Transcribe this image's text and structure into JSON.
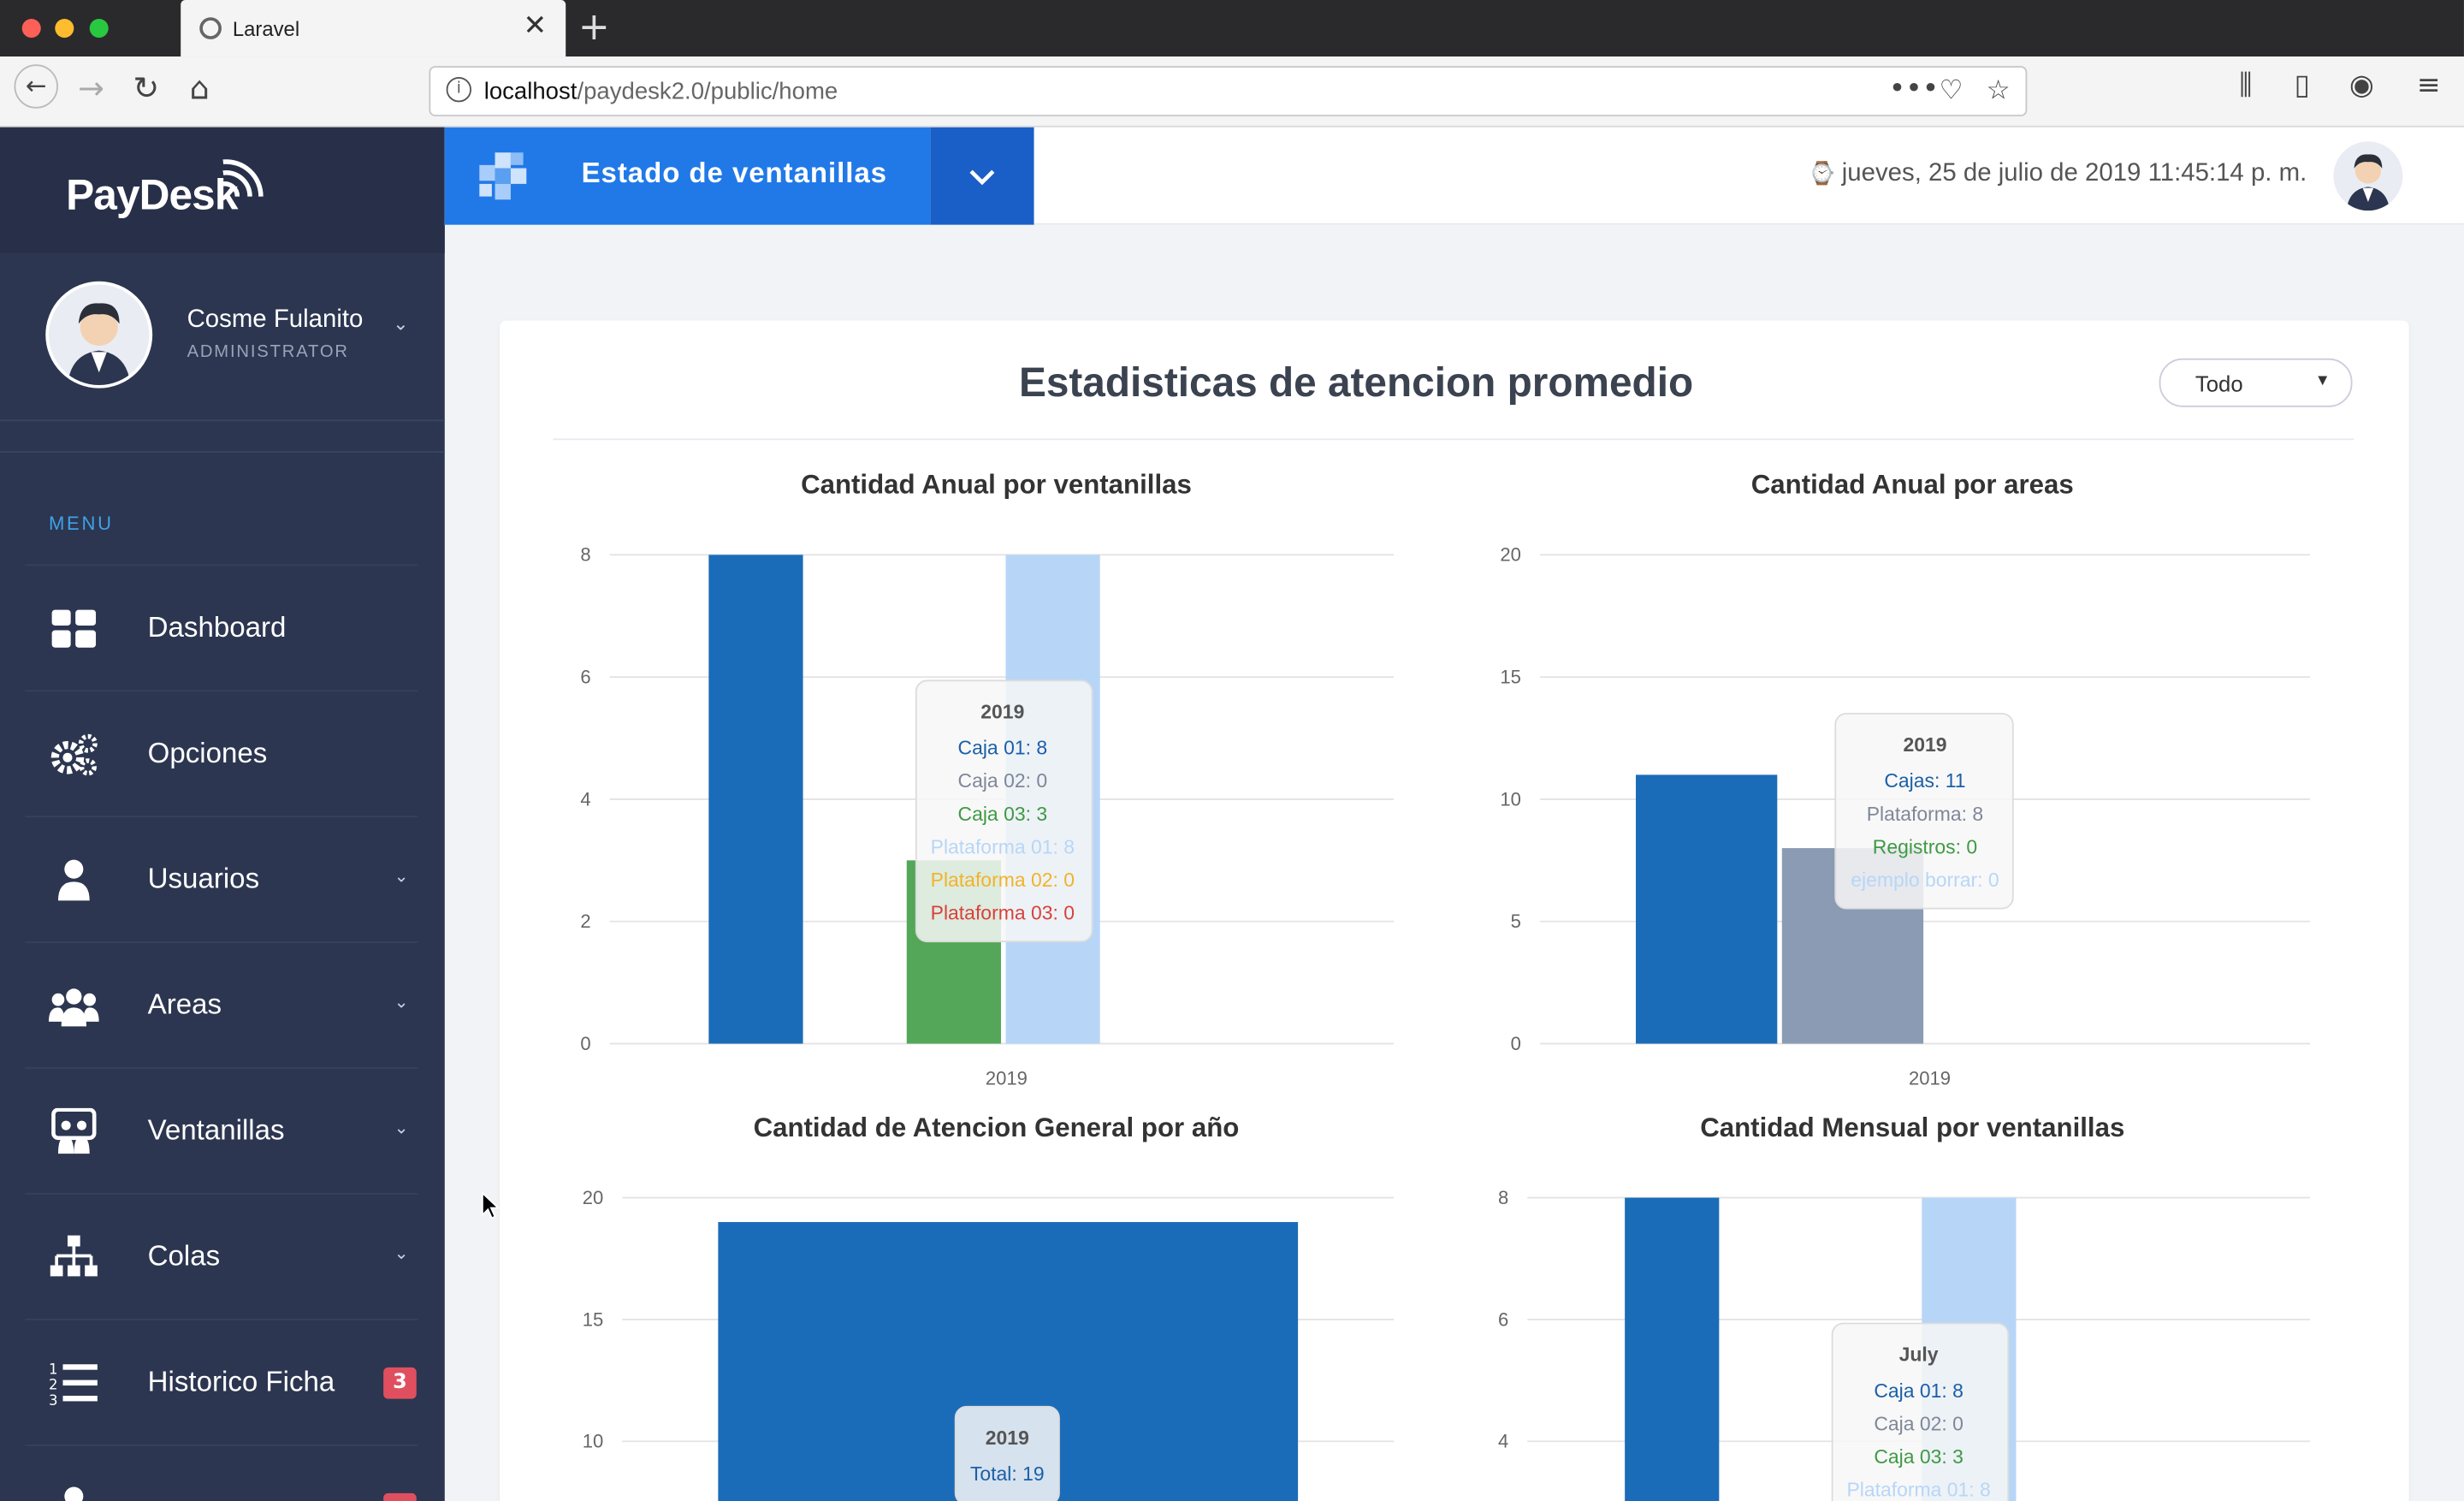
{
  "browser": {
    "tab_title": "Laravel",
    "url_host": "localhost",
    "url_path": "/paydesk2.0/public/home",
    "new_tab_symbol": "+",
    "close_symbol": "✕"
  },
  "sidebar": {
    "brand": "PayDesk",
    "user_name": "Cosme Fulanito",
    "user_role": "ADMINISTRATOR",
    "menu_label": "MENU",
    "items": [
      {
        "label": "Dashboard",
        "icon": "dashboard-grid-icon"
      },
      {
        "label": "Opciones",
        "icon": "gears-icon"
      },
      {
        "label": "Usuarios",
        "icon": "user-icon"
      },
      {
        "label": "Areas",
        "icon": "users-group-icon"
      },
      {
        "label": "Ventanillas",
        "icon": "window-icon"
      },
      {
        "label": "Colas",
        "icon": "sitemap-icon"
      },
      {
        "label": "Historico Ficha",
        "icon": "numbered-list-icon",
        "badge": "3"
      }
    ]
  },
  "topbar": {
    "title": "Estado de ventanillas",
    "datetime": "jueves, 25 de julio de 2019 11:45:14 p. m."
  },
  "card": {
    "title": "Estadisticas de atencion promedio",
    "filter_value": "Todo"
  },
  "colors": {
    "blue": "#1b6cb8",
    "gray": "#8a9bb3",
    "green": "#54a758",
    "lightblue": "#b7d6f7",
    "orange": "#f0b429",
    "red": "#d9413a",
    "accent": "#2179e8"
  },
  "chart_data": [
    {
      "type": "bar",
      "title": "Cantidad Anual por ventanillas",
      "categories": [
        "2019"
      ],
      "yticks": [
        "0",
        "2",
        "4",
        "6",
        "8"
      ],
      "ylim": [
        0,
        8
      ],
      "series": [
        {
          "name": "Caja 01",
          "values": [
            8
          ],
          "color": "#1b6cb8"
        },
        {
          "name": "Caja 02",
          "values": [
            0
          ],
          "color": "#8a9bb3"
        },
        {
          "name": "Caja 03",
          "values": [
            3
          ],
          "color": "#54a758"
        },
        {
          "name": "Plataforma 01",
          "values": [
            8
          ],
          "color": "#b7d6f7"
        },
        {
          "name": "Plataforma 02",
          "values": [
            0
          ],
          "color": "#f0b429"
        },
        {
          "name": "Plataforma 03",
          "values": [
            0
          ],
          "color": "#d9413a"
        }
      ],
      "tooltip": {
        "header": "2019",
        "lines": [
          "Caja 01: 8",
          "Caja 02: 0",
          "Caja 03: 3",
          "Plataforma 01: 8",
          "Plataforma 02: 0",
          "Plataforma 03: 0"
        ]
      }
    },
    {
      "type": "bar",
      "title": "Cantidad Anual por areas",
      "categories": [
        "2019"
      ],
      "yticks": [
        "0",
        "5",
        "10",
        "15",
        "20"
      ],
      "ylim": [
        0,
        20
      ],
      "series": [
        {
          "name": "Cajas",
          "values": [
            11
          ],
          "color": "#1b6cb8"
        },
        {
          "name": "Plataforma",
          "values": [
            8
          ],
          "color": "#8a9bb3"
        },
        {
          "name": "Registros",
          "values": [
            0
          ],
          "color": "#54a758"
        },
        {
          "name": "ejemplo borrar",
          "values": [
            0
          ],
          "color": "#b7d6f7"
        }
      ],
      "tooltip": {
        "header": "2019",
        "lines": [
          "Cajas: 11",
          "Plataforma: 8",
          "Registros: 0",
          "ejemplo borrar: 0"
        ]
      }
    },
    {
      "type": "bar",
      "title": "Cantidad de Atencion General por año",
      "categories": [
        "2019"
      ],
      "yticks": [
        "10",
        "15",
        "20"
      ],
      "ylim": [
        0,
        20
      ],
      "series": [
        {
          "name": "Total",
          "values": [
            19
          ],
          "color": "#1b6cb8"
        }
      ],
      "tooltip": {
        "header": "2019",
        "lines": [
          "Total: 19"
        ]
      }
    },
    {
      "type": "bar",
      "title": "Cantidad Mensual por ventanillas",
      "categories": [
        "July"
      ],
      "yticks": [
        "4",
        "6",
        "8"
      ],
      "ylim": [
        0,
        8
      ],
      "series": [
        {
          "name": "Caja 01",
          "values": [
            8
          ],
          "color": "#1b6cb8"
        },
        {
          "name": "Caja 02",
          "values": [
            0
          ],
          "color": "#8a9bb3"
        },
        {
          "name": "Caja 03",
          "values": [
            3
          ],
          "color": "#54a758"
        },
        {
          "name": "Plataforma 01",
          "values": [
            8
          ],
          "color": "#b7d6f7"
        }
      ],
      "tooltip": {
        "header": "July",
        "lines": [
          "Caja 01: 8",
          "Caja 02: 0",
          "Caja 03: 3",
          "Plataforma 01: 8"
        ]
      }
    }
  ]
}
